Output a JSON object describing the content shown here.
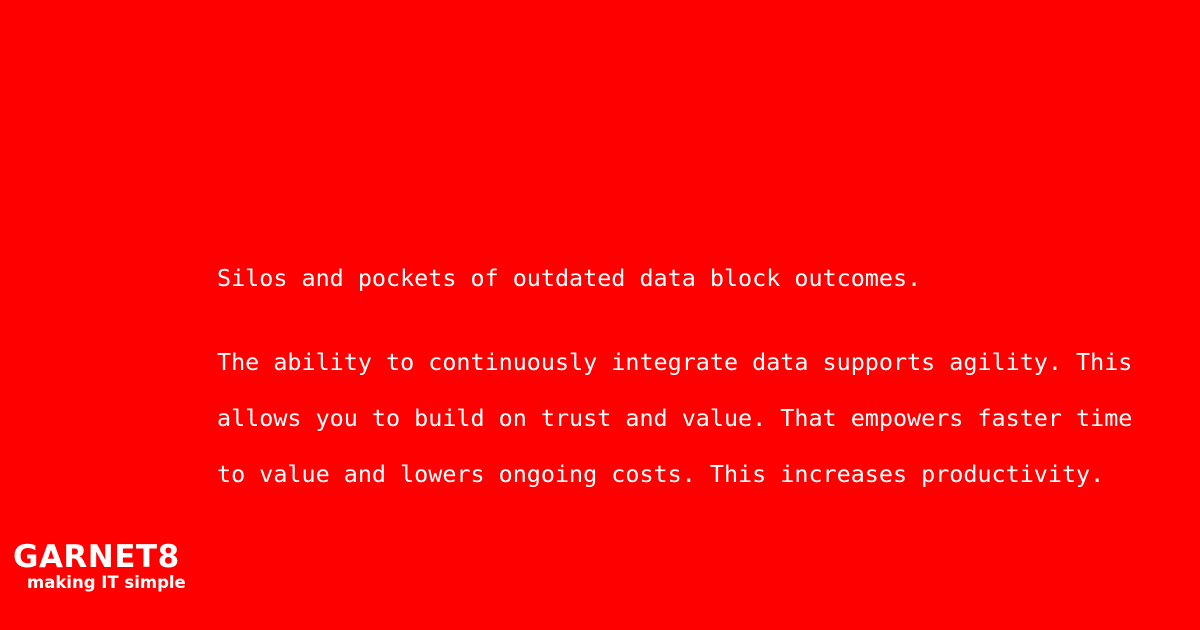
{
  "background_color": "#ff0000",
  "text_color": "#ffffff",
  "content": {
    "headline": "Silos and pockets of outdated data block outcomes.",
    "body_lines": [
      "The ability to continuously integrate data supports agility. This",
      "allows you to build on trust and value. That empowers faster time",
      "to value and lowers ongoing costs. This increases productivity."
    ]
  },
  "logo": {
    "name": "GARNET8",
    "tagline": "making IT simple"
  }
}
